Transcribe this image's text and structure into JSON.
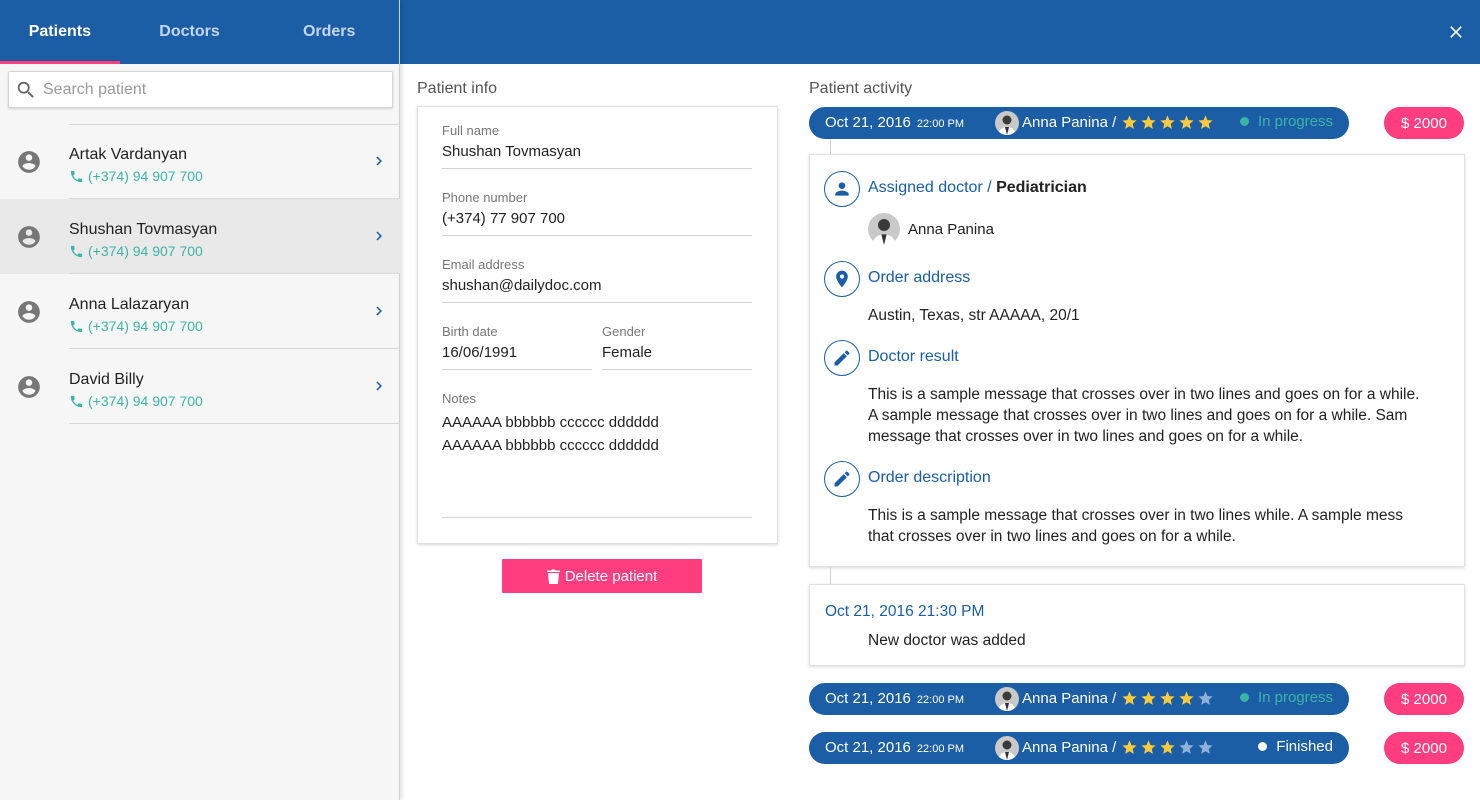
{
  "tabs": [
    {
      "label": "Patients",
      "active": true
    },
    {
      "label": "Doctors",
      "active": false
    },
    {
      "label": "Orders",
      "active": false
    }
  ],
  "search": {
    "placeholder": "Search patient"
  },
  "patients": [
    {
      "name": "Artak Vardanyan",
      "phone": "(+374) 94 907 700",
      "selected": false
    },
    {
      "name": "Shushan Tovmasyan",
      "phone": "(+374) 94 907 700",
      "selected": true
    },
    {
      "name": "Anna Lalazaryan",
      "phone": "(+374) 94 907 700",
      "selected": false
    },
    {
      "name": "David Billy",
      "phone": "(+374) 94 907 700",
      "selected": false
    }
  ],
  "patient_info": {
    "title": "Patient info",
    "full_name_label": "Full name",
    "full_name": "Shushan Tovmasyan",
    "phone_label": "Phone number",
    "phone": "(+374) 77 907 700",
    "email_label": "Email address",
    "email": "shushan@dailydoc.com",
    "birth_label": "Birth date",
    "birth": "16/06/1991",
    "gender_label": "Gender",
    "gender": "Female",
    "notes_label": "Notes",
    "notes_line1": "AAAAAA bbbbbb cccccc dddddd",
    "notes_line2": "AAAAAA bbbbbb cccccc dddddd",
    "delete_label": "Delete patient"
  },
  "activity": {
    "title": "Patient activity",
    "orders": [
      {
        "date": "Oct 21, 2016",
        "time": "22:00 PM",
        "doctor": "Anna Panina /",
        "rating": 5,
        "status": "In progress",
        "status_color": "#3cb5a4",
        "price": "$ 2000"
      },
      {
        "date": "Oct 21, 2016",
        "time": "22:00 PM",
        "doctor": "Anna Panina /",
        "rating": 4,
        "status": "In progress",
        "status_color": "#3cb5a4",
        "price": "$ 2000"
      },
      {
        "date": "Oct 21, 2016",
        "time": "22:00 PM",
        "doctor": "Anna Panina /",
        "rating": 3,
        "status": "Finished",
        "status_color": "#ffffff",
        "price": "$ 2000"
      }
    ],
    "details": {
      "assigned_label": "Assigned doctor /",
      "assigned_specialty": "Pediatrician",
      "doctor_name": "Anna Panina",
      "address_label": "Order address",
      "address": "Austin, Texas, str AAAAA, 20/1",
      "result_label": "Doctor result",
      "result_line1": "This is a sample message that crosses over in two lines and goes on for a while.",
      "result_line2": "A sample message that crosses over in two lines and goes on for a while. Sam",
      "result_line3": "message that crosses over in two lines and goes on for a while.",
      "description_label": "Order description",
      "description_line1": "This is a sample message that crosses over in two lines while. A sample mess",
      "description_line2": "that crosses over in two lines and goes on for a while."
    },
    "event": {
      "date": "Oct 21, 2016 21:30 PM",
      "text": "New doctor was added"
    }
  },
  "colors": {
    "primary": "#1b5ea6",
    "accent": "#ff3d7f",
    "phone": "#3cb5a4",
    "star": "#ffc93c",
    "star_empty": "#8fb0d8"
  },
  "icons": [
    "search-icon",
    "account-circle-icon",
    "phone-icon",
    "chevron-right-icon",
    "close-icon",
    "trash-icon",
    "star-icon",
    "person-icon",
    "location-pin-icon",
    "pencil-icon"
  ]
}
